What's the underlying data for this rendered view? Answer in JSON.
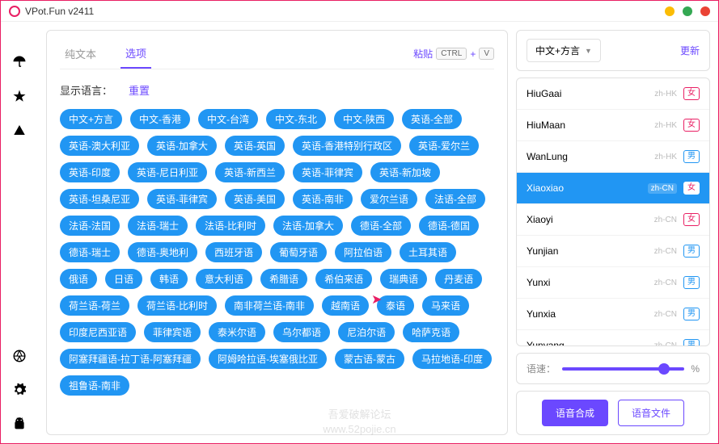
{
  "window": {
    "title": "VPot.Fun v2411"
  },
  "tabs": {
    "plaintext": "纯文本",
    "options": "选项"
  },
  "paste": {
    "label": "粘贴",
    "key1": "CTRL",
    "plus": "+",
    "key2": "V"
  },
  "langHeader": {
    "label": "显示语言：",
    "reset": "重置"
  },
  "tags": [
    "中文+方言",
    "中文-香港",
    "中文-台湾",
    "中文-东北",
    "中文-陕西",
    "英语-全部",
    "英语-澳大利亚",
    "英语-加拿大",
    "英语-英国",
    "英语-香港特别行政区",
    "英语-爱尔兰",
    "英语-印度",
    "英语-尼日利亚",
    "英语-新西兰",
    "英语-菲律宾",
    "英语-新加坡",
    "英语-坦桑尼亚",
    "英语-菲律宾",
    "英语-美国",
    "英语-南非",
    "爱尔兰语",
    "法语-全部",
    "法语-法国",
    "法语-瑞士",
    "法语-比利时",
    "法语-加拿大",
    "德语-全部",
    "德语-德国",
    "德语-瑞士",
    "德语-奥地利",
    "西班牙语",
    "葡萄牙语",
    "阿拉伯语",
    "土耳其语",
    "俄语",
    "日语",
    "韩语",
    "意大利语",
    "希腊语",
    "希伯来语",
    "瑞典语",
    "丹麦语",
    "荷兰语-荷兰",
    "荷兰语-比利时",
    "南非荷兰语-南非",
    "越南语",
    "泰语",
    "马来语",
    "印度尼西亚语",
    "菲律宾语",
    "泰米尔语",
    "乌尔都语",
    "尼泊尔语",
    "哈萨克语",
    "阿塞拜疆语-拉丁语-阿塞拜疆",
    "阿姆哈拉语-埃塞俄比亚",
    "蒙古语-蒙古",
    "马拉地语-印度",
    "祖鲁语-南非"
  ],
  "rightTop": {
    "dropdown": "中文+方言",
    "update": "更新"
  },
  "genders": {
    "f": "女",
    "m": "男"
  },
  "voices": [
    {
      "name": "HiuGaai",
      "locale": "zh-HK",
      "g": "f"
    },
    {
      "name": "HiuMaan",
      "locale": "zh-HK",
      "g": "f"
    },
    {
      "name": "WanLung",
      "locale": "zh-HK",
      "g": "m"
    },
    {
      "name": "Xiaoxiao",
      "locale": "zh-CN",
      "g": "f",
      "selected": true
    },
    {
      "name": "Xiaoyi",
      "locale": "zh-CN",
      "g": "f"
    },
    {
      "name": "Yunjian",
      "locale": "zh-CN",
      "g": "m"
    },
    {
      "name": "Yunxi",
      "locale": "zh-CN",
      "g": "m"
    },
    {
      "name": "Yunxia",
      "locale": "zh-CN",
      "g": "m"
    },
    {
      "name": "Yunyang",
      "locale": "zh-CN",
      "g": "m"
    }
  ],
  "speed": {
    "label": "语速：",
    "pct": "%"
  },
  "actions": {
    "synth": "语音合成",
    "file": "语音文件"
  },
  "watermark": {
    "line1": "吾爱破解论坛",
    "line2": "www.52pojie.cn"
  }
}
